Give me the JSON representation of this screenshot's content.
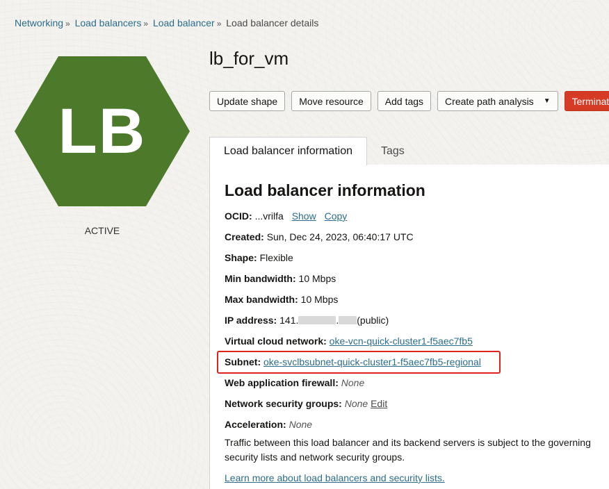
{
  "breadcrumb": {
    "items": [
      "Networking",
      "Load balancers",
      "Load balancer"
    ],
    "current": "Load balancer details",
    "separator": "»"
  },
  "badge": {
    "text": "LB",
    "color": "#4d7a2a",
    "status": "ACTIVE"
  },
  "title": "lb_for_vm",
  "toolbar": {
    "update_shape": "Update shape",
    "move_resource": "Move resource",
    "add_tags": "Add tags",
    "create_path_analysis": "Create path analysis",
    "terminate": "Terminate"
  },
  "tabs": [
    "Load balancer information",
    "Tags"
  ],
  "info": {
    "heading": "Load balancer information",
    "ocid_label": "OCID:",
    "ocid_value": "...vrilfa",
    "show": "Show",
    "copy": "Copy",
    "created_label": "Created:",
    "created_value": "Sun, Dec 24, 2023, 06:40:17 UTC",
    "shape_label": "Shape:",
    "shape_value": "Flexible",
    "min_bw_label": "Min bandwidth:",
    "min_bw_value": "10 Mbps",
    "max_bw_label": "Max bandwidth:",
    "max_bw_value": "10 Mbps",
    "ip_label": "IP address:",
    "ip_prefix": "141.",
    "ip_dot": ".",
    "ip_suffix": "(public)",
    "vcn_label": "Virtual cloud network:",
    "vcn_value": "oke-vcn-quick-cluster1-f5aec7fb5",
    "subnet_label": "Subnet:",
    "subnet_value": "oke-svclbsubnet-quick-cluster1-f5aec7fb5-regional",
    "waf_label": "Web application firewall:",
    "waf_value": "None",
    "nsg_label": "Network security groups:",
    "nsg_value": "None",
    "edit": "Edit",
    "accel_label": "Acceleration:",
    "accel_value": "None",
    "paragraph": "Traffic between this load balancer and its backend servers is subject to the governing security lists and network security groups.",
    "learn_more": "Learn more about load balancers and security lists."
  },
  "colors": {
    "link": "#2b6d8a",
    "danger": "#d63b25",
    "highlight": "#e0201b"
  }
}
